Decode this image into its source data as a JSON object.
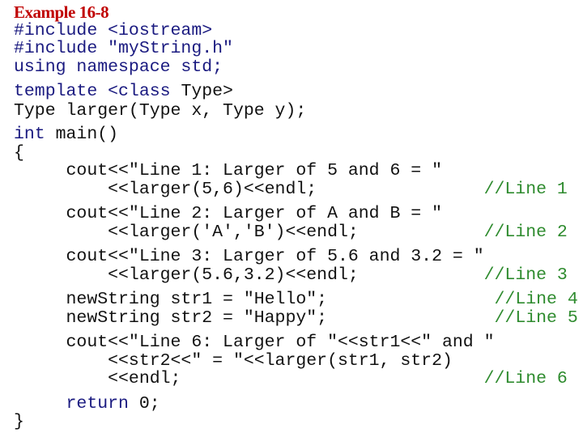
{
  "title": "Example 16-8",
  "colors": {
    "title": "#c00000",
    "keyword": "#1a1a80",
    "comment": "#2e8b2e",
    "text": "#111111"
  },
  "code": [
    {
      "segments": [
        {
          "t": "#include <iostream>",
          "c": "kw"
        }
      ]
    },
    {
      "segments": [
        {
          "t": "#include \"myString.h\"",
          "c": "kw"
        }
      ]
    },
    {
      "segments": [
        {
          "t": "using namespace std;",
          "c": "kw"
        }
      ]
    },
    {
      "segments": [
        {
          "t": "template <class ",
          "c": "kw"
        },
        {
          "t": "Type>",
          "c": ""
        }
      ]
    },
    {
      "segments": [
        {
          "t": "Type larger(Type x, Type y);",
          "c": ""
        }
      ]
    },
    {
      "segments": [
        {
          "t": "int",
          "c": "kw"
        },
        {
          "t": " main()",
          "c": ""
        }
      ]
    },
    {
      "segments": [
        {
          "t": "{",
          "c": ""
        }
      ]
    },
    {
      "segments": [
        {
          "t": "     cout<<\"Line 1: Larger of 5 and 6 = \"",
          "c": ""
        }
      ]
    },
    {
      "segments": [
        {
          "t": "         <<larger(5,6)<<endl;",
          "c": ""
        },
        {
          "t": "                //Line 1",
          "c": "cm"
        }
      ]
    },
    {
      "segments": [
        {
          "t": "     cout<<\"Line 2: Larger of A and B = \"",
          "c": ""
        }
      ]
    },
    {
      "segments": [
        {
          "t": "         <<larger('A','B')<<endl;",
          "c": ""
        },
        {
          "t": "            //Line 2",
          "c": "cm"
        }
      ]
    },
    {
      "segments": [
        {
          "t": "     cout<<\"Line 3: Larger of 5.6 and 3.2 = \"",
          "c": ""
        }
      ]
    },
    {
      "segments": [
        {
          "t": "         <<larger(5.6,3.2)<<endl;",
          "c": ""
        },
        {
          "t": "            //Line 3",
          "c": "cm"
        }
      ]
    },
    {
      "segments": [
        {
          "t": "     newString str1 = \"Hello\";",
          "c": ""
        },
        {
          "t": "                //Line 4",
          "c": "cm"
        }
      ]
    },
    {
      "segments": [
        {
          "t": "     newString str2 = \"Happy\";",
          "c": ""
        },
        {
          "t": "                //Line 5",
          "c": "cm"
        }
      ]
    },
    {
      "segments": [
        {
          "t": "     cout<<\"Line 6: Larger of \"<<str1<<\" and \"",
          "c": ""
        }
      ]
    },
    {
      "segments": [
        {
          "t": "         <<str2<<\" = \"<<larger(str1, str2)",
          "c": ""
        }
      ]
    },
    {
      "segments": [
        {
          "t": "         <<endl;",
          "c": ""
        },
        {
          "t": "                             //Line 6",
          "c": "cm"
        }
      ]
    },
    {
      "segments": [
        {
          "t": "     ",
          "c": ""
        },
        {
          "t": "return",
          "c": "kw"
        },
        {
          "t": " 0;",
          "c": ""
        }
      ]
    },
    {
      "segments": [
        {
          "t": "}",
          "c": ""
        }
      ]
    }
  ]
}
